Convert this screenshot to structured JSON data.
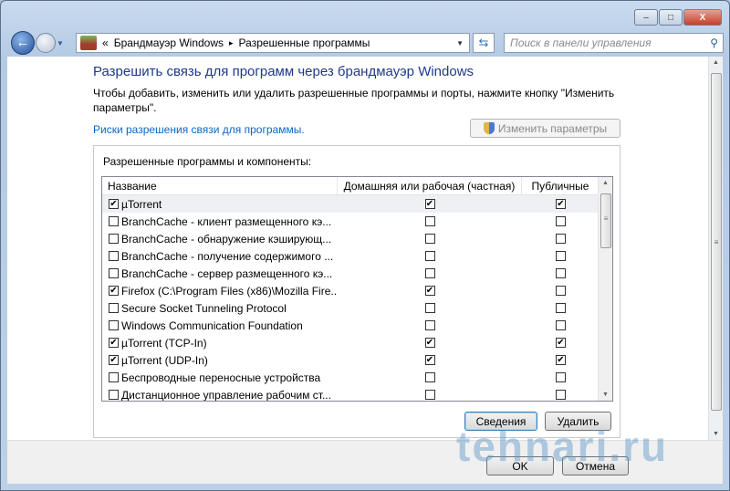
{
  "window": {
    "minimize": "–",
    "maximize": "□",
    "close": "X"
  },
  "nav": {
    "breadcrumb": [
      "Брандмауэр Windows",
      "Разрешенные программы"
    ],
    "breadcrumb_prefix": "«",
    "separator": "▸",
    "search_placeholder": "Поиск в панели управления"
  },
  "main": {
    "title": "Разрешить связь для программ через брандмауэр Windows",
    "description": "Чтобы добавить, изменить или удалить разрешенные программы и порты, нажмите кнопку \"Изменить параметры\".",
    "risk_link": "Риски разрешения связи для программы.",
    "change_button": "Изменить параметры",
    "group_label": "Разрешенные программы и компоненты:",
    "columns": [
      "Название",
      "Домашняя или рабочая (частная)",
      "Публичные"
    ],
    "rows": [
      {
        "name": "µTorrent",
        "enabled": true,
        "home": true,
        "public": true
      },
      {
        "name": "BranchCache - клиент размещенного кэ...",
        "enabled": false,
        "home": false,
        "public": false
      },
      {
        "name": "BranchCache - обнаружение кэширующ...",
        "enabled": false,
        "home": false,
        "public": false
      },
      {
        "name": "BranchCache - получение содержимого ...",
        "enabled": false,
        "home": false,
        "public": false
      },
      {
        "name": "BranchCache - сервер размещенного кэ...",
        "enabled": false,
        "home": false,
        "public": false
      },
      {
        "name": "Firefox (C:\\Program Files (x86)\\Mozilla Fire...",
        "enabled": true,
        "home": true,
        "public": false
      },
      {
        "name": "Secure Socket Tunneling Protocol",
        "enabled": false,
        "home": false,
        "public": false
      },
      {
        "name": "Windows Communication Foundation",
        "enabled": false,
        "home": false,
        "public": false
      },
      {
        "name": "µTorrent (TCP-In)",
        "enabled": true,
        "home": true,
        "public": true
      },
      {
        "name": "µTorrent (UDP-In)",
        "enabled": true,
        "home": true,
        "public": true
      },
      {
        "name": "Беспроводные переносные устройства",
        "enabled": false,
        "home": false,
        "public": false
      },
      {
        "name": "Дистанционное управление рабочим ст...",
        "enabled": false,
        "home": false,
        "public": false
      }
    ],
    "details_button": "Сведения",
    "remove_button": "Удалить"
  },
  "footer": {
    "ok": "OK",
    "cancel": "Отмена"
  },
  "watermark": "tehnari.ru"
}
